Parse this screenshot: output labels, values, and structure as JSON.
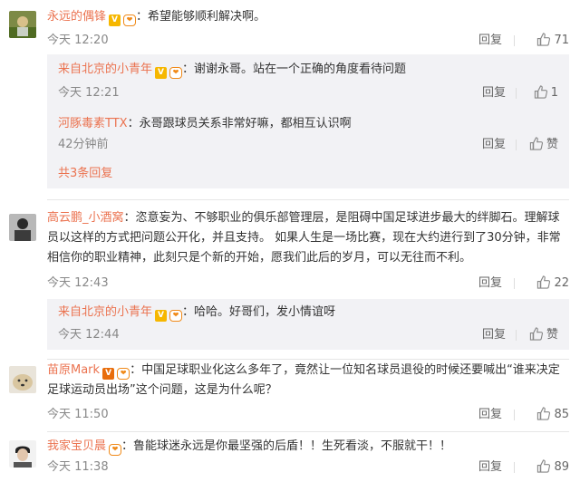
{
  "comments": [
    {
      "user": "永远的偶锋",
      "text": "：希望能够顺利解决啊。",
      "time": "今天 12:20",
      "reply_label": "回复",
      "likes": "71",
      "replies": [
        {
          "user": "来自北京的小青年",
          "text": "：谢谢永哥。站在一个正确的角度看待问题",
          "time": "今天 12:21",
          "reply_label": "回复",
          "likes": "1"
        },
        {
          "user": "河豚毒素TTX",
          "text": "：永哥跟球员关系非常好嘛，都相互认识啊",
          "time": "42分钟前",
          "reply_label": "回复",
          "likes": "赞"
        }
      ],
      "more_label": "共3条回复"
    },
    {
      "user": "高云鹏_小酒窝",
      "text_line1": "：恣意妄为、不够职业的俱乐部管理层，是阻碍中国足球进步最大的绊脚石。理解球",
      "text_line2": "员以这样的方式把问题公开化，并且支持。  如果人生是一场比赛，现在大约进行到了30分钟，非常",
      "text_line3": "相信你的职业精神，此刻只是个新的开始，愿我们此后的岁月，可以无往而不利。",
      "time": "今天 12:43",
      "reply_label": "回复",
      "likes": "22",
      "replies": [
        {
          "user": "来自北京的小青年",
          "text": "：哈哈。好哥们，发小情谊呀",
          "time": "今天 12:44",
          "reply_label": "回复",
          "likes": "赞"
        }
      ]
    },
    {
      "user": "苗原Mark",
      "text_line1": "：中国足球职业化这么多年了，竟然让一位知名球员退役的时候还要喊出“谁来决定",
      "text_line2": "足球运动员出场”这个问题，这是为什么呢？",
      "time": "今天 11:50",
      "reply_label": "回复",
      "likes": "85"
    },
    {
      "user": "我家宝贝晨",
      "text": "：鲁能球迷永远是你最坚强的后盾！！生死看淡，不服就干！！",
      "time": "今天 11:38",
      "reply_label": "回复",
      "likes": "89"
    }
  ]
}
